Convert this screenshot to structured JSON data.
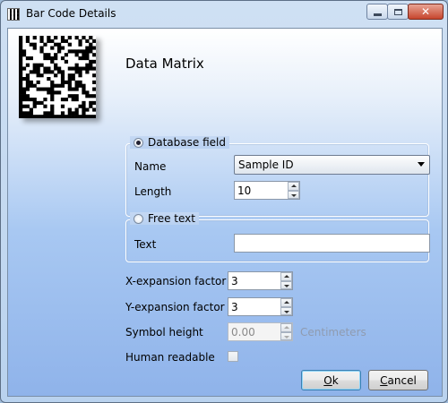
{
  "window": {
    "title": "Bar Code Details",
    "close_glyph": "✕"
  },
  "heading": "Data Matrix",
  "database_group": {
    "option_label": "Database field",
    "selected": true,
    "name_label": "Name",
    "name_value": "Sample ID",
    "length_label": "Length",
    "length_value": "10"
  },
  "freetext_group": {
    "option_label": "Free text",
    "selected": false,
    "text_label": "Text",
    "text_value": ""
  },
  "x_expansion": {
    "label": "X-expansion factor",
    "value": "3"
  },
  "y_expansion": {
    "label": "Y-expansion factor",
    "value": "3"
  },
  "symbol_height": {
    "label": "Symbol height",
    "value": "0.00",
    "unit": "Centimeters"
  },
  "human_readable": {
    "label": "Human readable",
    "checked": false
  },
  "buttons": {
    "ok_mnemonic": "O",
    "ok_rest": "k",
    "cancel_mnemonic": "C",
    "cancel_rest": "ancel"
  }
}
